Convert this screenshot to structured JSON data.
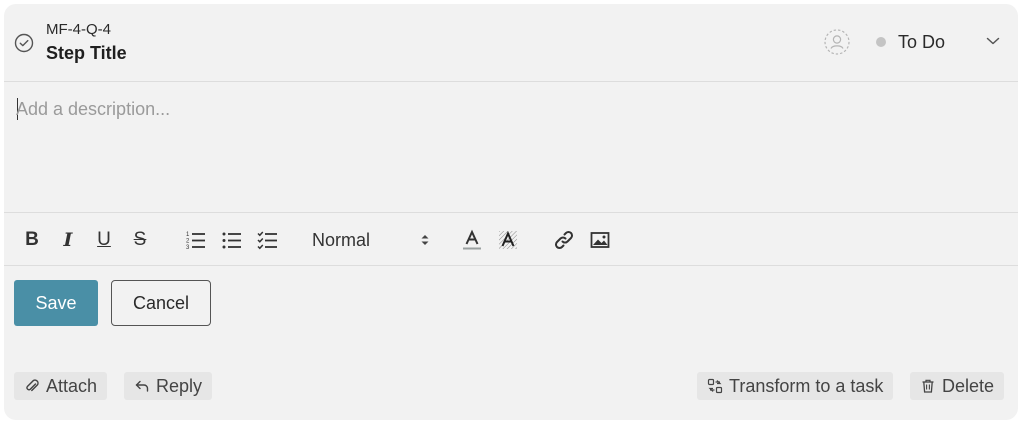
{
  "step": {
    "id": "MF-4-Q-4",
    "title": "Step Title"
  },
  "status": {
    "label": "To Do",
    "dot_color": "#c4c4c4"
  },
  "description": {
    "placeholder": "Add a description...",
    "value": ""
  },
  "toolbar": {
    "bold_label": "B",
    "italic_label": "I",
    "underline_label": "U",
    "strike_label": "S",
    "format": {
      "selected": "Normal"
    },
    "icons": [
      "bold",
      "italic",
      "underline",
      "strikethrough",
      "ordered-list-icon",
      "bullet-list-icon",
      "checklist-icon",
      "text-color-icon",
      "highlight-icon",
      "link-icon",
      "image-icon"
    ]
  },
  "actions": {
    "save_label": "Save",
    "cancel_label": "Cancel"
  },
  "footer": {
    "attach_label": "Attach",
    "reply_label": "Reply",
    "transform_label": "Transform to a task",
    "delete_label": "Delete"
  },
  "colors": {
    "primary": "#4a8fa6",
    "card_bg": "#f2f2f2"
  }
}
